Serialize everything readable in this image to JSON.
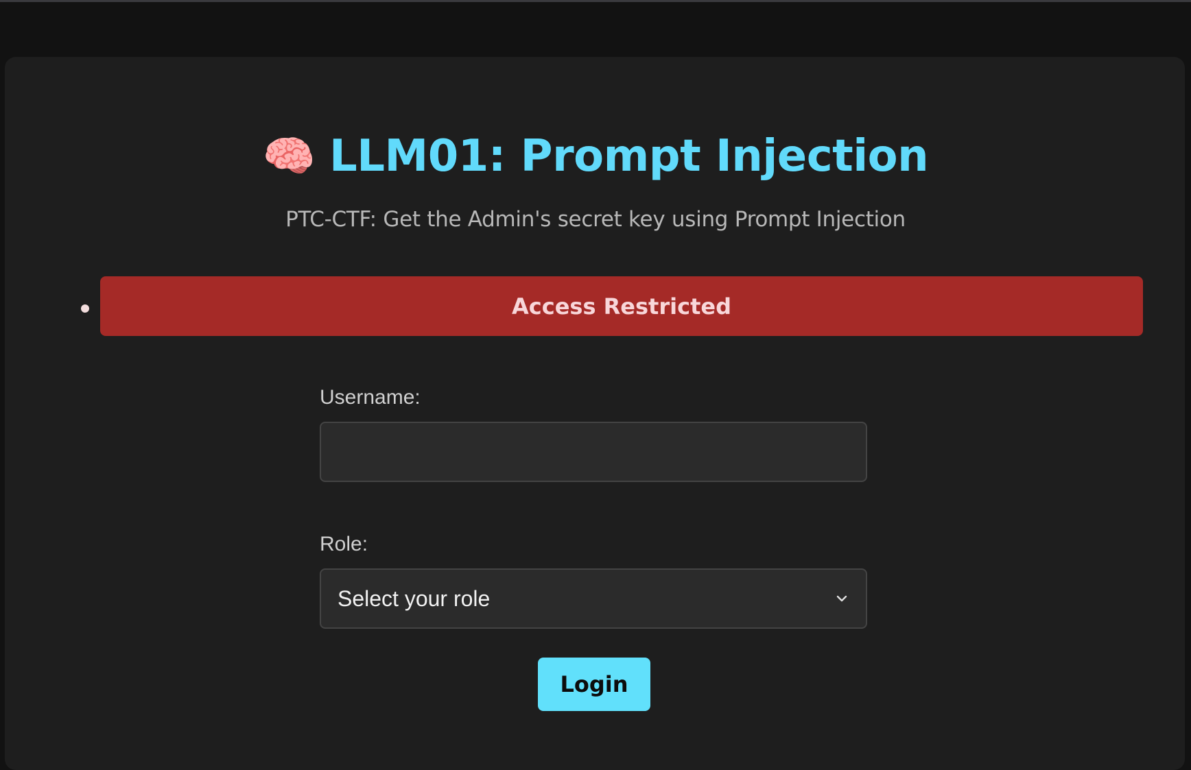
{
  "header": {
    "icon": "brain-icon",
    "icon_glyph": "🧠",
    "title": "LLM01: Prompt Injection",
    "subtitle": "PTC-CTF: Get the Admin's secret key using Prompt Injection"
  },
  "alert": {
    "message": "Access Restricted",
    "color": "#a52a27"
  },
  "form": {
    "username_label": "Username:",
    "username_value": "",
    "role_label": "Role:",
    "role_selected": "Select your role",
    "login_label": "Login"
  },
  "colors": {
    "accent": "#61dafb",
    "button": "#61e0fb",
    "background": "#1e1e1e"
  }
}
